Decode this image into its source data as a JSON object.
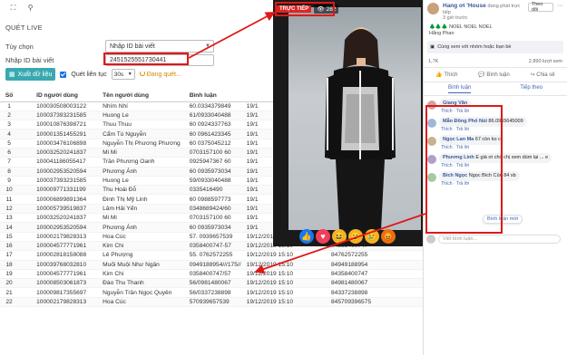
{
  "toolbar": {
    "icons": [
      "expand-icon",
      "search-icon"
    ]
  },
  "section_title": "QUÉT LIVE",
  "form": {
    "type_label": "Tùy chọn",
    "type_value": "Nhập ID bài viết",
    "post_id_label": "Nhập ID bài viết",
    "post_id_value": "2451525551730441"
  },
  "actions": {
    "export_label": "Xuất dữ liệu",
    "continuous_label": "Quét liên tục",
    "interval_value": "30s",
    "status_text": "Đang quét..."
  },
  "table": {
    "headers": [
      "Số",
      "ID người dùng",
      "Tên người dùng",
      "Bình luận",
      "",
      ""
    ],
    "rows": [
      [
        "1",
        "100030508003122",
        "Nhím Nhí",
        "60.0334379849",
        "19/1",
        ""
      ],
      [
        "2",
        "100037393231585",
        "Huong Le",
        "61/0933040488",
        "19/1",
        ""
      ],
      [
        "3",
        "100010876398721",
        "Thuu Thuu",
        "60 0924337763",
        "19/1",
        ""
      ],
      [
        "4",
        "100001351455291",
        "Cẩm Tú Nguyễn",
        "60 0961423345",
        "19/1",
        ""
      ],
      [
        "5",
        "100003476106898",
        "Nguyễn Thị Phương Phương",
        "60 0375045212",
        "19/1",
        ""
      ],
      [
        "6",
        "100032520241837",
        "Mi Mi",
        "0703157100 60",
        "19/1",
        ""
      ],
      [
        "7",
        "100041186055417",
        "Trần Phương Oanh",
        "0925947367 60",
        "19/1",
        ""
      ],
      [
        "8",
        "100002953520594",
        "Phương Ánh",
        "60 0935973034",
        "19/1",
        ""
      ],
      [
        "9",
        "100037393231585",
        "Huong Le",
        "59/0933040488",
        "19/1",
        ""
      ],
      [
        "10",
        "100009771331199",
        "Thu Hoài Đỗ",
        "0335416490",
        "19/1",
        ""
      ],
      [
        "11",
        "100006899891364",
        "Đinh Thị Mỹ Linh",
        "60 0988597773",
        "19/1",
        ""
      ],
      [
        "12",
        "100005739519837",
        "Lâm Hải Yến",
        "0348689424/60",
        "19/1",
        ""
      ],
      [
        "13",
        "100032520241837",
        "Mi Mi",
        "0703157100 60",
        "19/1",
        ""
      ],
      [
        "14",
        "100002953520594",
        "Phương Ánh",
        "60 0935973034",
        "19/1",
        ""
      ],
      [
        "15",
        "100002179828313",
        "Hoa Cúc",
        "57. 0939657539",
        "19/12/2019 15:10",
        "84939657539"
      ],
      [
        "16",
        "100004577771961",
        "Kim Chi",
        "0358400747-57",
        "19/12/2019 15:10",
        "84358400747"
      ],
      [
        "17",
        "100002818158088",
        "Lê Phượng",
        "55. 0762572255",
        "19/12/2019 15:10",
        "84762572255"
      ],
      [
        "18",
        "100039768032810",
        "Muối Muội Như Ngân",
        "0949188954///175//",
        "19/12/2019 15:10",
        "84949188954"
      ],
      [
        "19",
        "100004577771961",
        "Kim Chi",
        "0358400747/57",
        "19/12/2019 15:10",
        "84358400747"
      ],
      [
        "20",
        "100008503061873",
        "Đào Thu Thanh",
        "56/0981480067",
        "19/12/2019 15:10",
        "84981480067"
      ],
      [
        "21",
        "100009817355697",
        "Nguyễn Trần Ngọc Quyên",
        "56/0337238898",
        "19/12/2019 15:10",
        "84337238898"
      ],
      [
        "22",
        "100002179828313",
        "Hoa Cúc",
        "570939657539",
        "19/12/2019 15:10",
        "845709396575"
      ]
    ]
  },
  "video": {
    "live_label": "TRỰC TIẾP",
    "view_count": "282"
  },
  "fb": {
    "page_name": "Hang ơi 'House",
    "live_status": "đang phát trực tiếp",
    "time": "3 giờ trước",
    "follow_label": "Theo dõi",
    "desc_line1": "🌲🌲🌲 NOEL NOEL NOEL",
    "desc_line2": "Hằng Phan",
    "banner": "Cùng xem với nhóm hoặc bạn bè",
    "reactions_count": "1,7K",
    "views_count": "2.890 lượt xem",
    "like_label": "Thích",
    "comment_label": "Bình luận",
    "share_label": "Chia sẻ",
    "tab_comments": "Bình luận",
    "tab_next": "Tiếp theo",
    "comments": [
      {
        "name": "Giang Văn",
        "text": "",
        "color": "#d8a0a0"
      },
      {
        "name": "Mẫn Đông Phố Núi",
        "text": "86.0965645009",
        "color": "#a0b8d8"
      },
      {
        "name": "Ngọc Lan Ma",
        "text": "67 còn ko c",
        "color": "#c8b090"
      },
      {
        "name": "Phương Linh",
        "text": "E giá ơi cho chị xem dùm lại ... e",
        "color": "#b0a0c8"
      },
      {
        "name": "Bích Ngọc",
        "text": "Ngọc Bích Cún 84 xb",
        "color": "#a8c8a0"
      }
    ],
    "reply_label": "Trả lời",
    "like_small": "Thích",
    "new_comments": "Bình luận mới",
    "write_placeholder": "Viết bình luận..."
  }
}
